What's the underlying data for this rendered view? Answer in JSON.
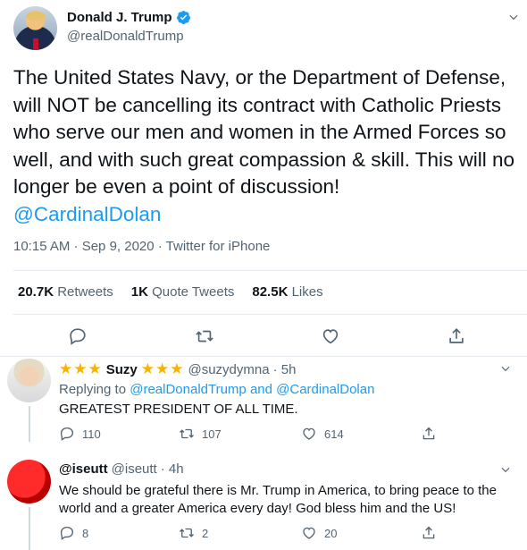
{
  "tweet": {
    "author_name": "Donald J. Trump",
    "author_handle": "@realDonaldTrump",
    "text": "The United States Navy, or the Department of Defense, will NOT be cancelling its contract with Catholic Priests who serve our men and women in the Armed Forces so well, and with such great compassion & skill. This will no longer be even a point of discussion!",
    "mention": "@CardinalDolan",
    "meta": "10:15 AM · Sep 9, 2020 · Twitter for iPhone",
    "stats": {
      "retweets_count": "20.7K",
      "retweets_label": "Retweets",
      "quotes_count": "1K",
      "quotes_label": "Quote Tweets",
      "likes_count": "82.5K",
      "likes_label": "Likes"
    }
  },
  "replies": [
    {
      "name": "Suzy",
      "stars_left": "★★★",
      "stars_right": "★★★",
      "handle": "@suzydymna",
      "time": "· 5h",
      "replying_prefix": "Replying to",
      "replying_to_1": "@realDonaldTrump",
      "replying_and": "and",
      "replying_to_2": "@CardinalDolan",
      "text": "GREATEST PRESIDENT OF ALL TIME.",
      "reply_count": "110",
      "retweet_count": "107",
      "like_count": "614"
    },
    {
      "name": "@iseutt",
      "handle": "@iseutt",
      "time": "· 4h",
      "text": "We should be grateful there is Mr. Trump in America, to bring peace to the world and a greater America every day! God bless him and the US!",
      "reply_count": "8",
      "retweet_count": "2",
      "like_count": "20"
    }
  ],
  "colors": {
    "accent": "#1d9bf0",
    "muted": "#536471",
    "star": "#f4b400"
  },
  "icons": [
    "verified-icon",
    "more-icon",
    "reply-icon",
    "retweet-icon",
    "like-icon",
    "share-icon"
  ]
}
